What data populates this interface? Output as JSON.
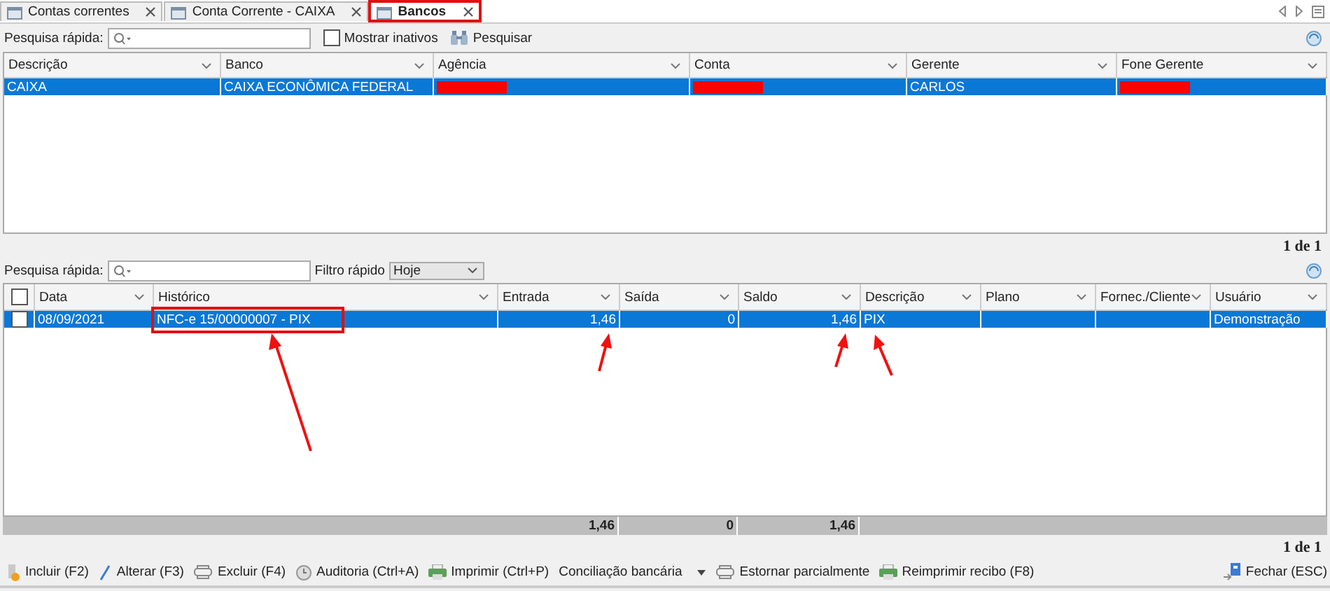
{
  "tabs": [
    {
      "label": "Contas correntes",
      "selected": false,
      "highlighted": false
    },
    {
      "label": "Conta Corrente - CAIXA",
      "selected": false,
      "highlighted": false
    },
    {
      "label": "Bancos",
      "selected": true,
      "highlighted": true
    }
  ],
  "search_bar": {
    "label": "Pesquisa rápida:",
    "show_inactive": {
      "label": "Mostrar inativos",
      "checked": false
    },
    "search_button": "Pesquisar"
  },
  "banks_table": {
    "columns": [
      {
        "label": "Descrição"
      },
      {
        "label": "Banco"
      },
      {
        "label": "Agência"
      },
      {
        "label": "Conta"
      },
      {
        "label": "Gerente"
      },
      {
        "label": "Fone Gerente"
      }
    ],
    "rows": [
      {
        "selected": true,
        "cells": [
          {
            "kind": "text",
            "text": "CAIXA"
          },
          {
            "kind": "text",
            "text": "CAIXA ECONÔMICA FEDERAL"
          },
          {
            "kind": "redacted"
          },
          {
            "kind": "redacted"
          },
          {
            "kind": "text",
            "text": "CARLOS"
          },
          {
            "kind": "redacted"
          }
        ]
      }
    ],
    "pager": "1 de 1"
  },
  "filter_bar": {
    "label": "Pesquisa rápida:",
    "filter_label": "Filtro rápido",
    "filter_value": "Hoje"
  },
  "entries_table": {
    "header_checked": false,
    "columns": [
      {
        "label": "Data",
        "kind": "text"
      },
      {
        "label": "Histórico",
        "kind": "text"
      },
      {
        "label": "Entrada",
        "kind": "number"
      },
      {
        "label": "Saída",
        "kind": "number"
      },
      {
        "label": "Saldo",
        "kind": "number"
      },
      {
        "label": "Descrição",
        "kind": "text"
      },
      {
        "label": "Plano",
        "kind": "text"
      },
      {
        "label": "Fornec./Cliente",
        "kind": "text"
      },
      {
        "label": "Usuário",
        "kind": "text"
      }
    ],
    "rows": [
      {
        "selected": true,
        "checked": false,
        "cells": [
          {
            "text": "08/09/2021"
          },
          {
            "text": "NFC-e 15/00000007 - PIX",
            "highlighted": true
          },
          {
            "text": "1,46"
          },
          {
            "text": "0"
          },
          {
            "text": "1,46"
          },
          {
            "text": "PIX"
          },
          {},
          {},
          {
            "text": "Demonstração"
          }
        ]
      }
    ],
    "totals": [
      "1,46",
      "0",
      "1,46"
    ],
    "pager": "1 de 1"
  },
  "actions": [
    {
      "label": "Incluir (F2)",
      "kind": "add"
    },
    {
      "label": "Alterar (F3)",
      "kind": "edit"
    },
    {
      "label": "Excluir (F4)",
      "kind": "delete"
    },
    {
      "label": "Auditoria (Ctrl+A)",
      "kind": "audit"
    },
    {
      "label": "Imprimir (Ctrl+P)",
      "kind": "print"
    },
    {
      "label": "Conciliação bancária",
      "kind": "dropdown"
    },
    {
      "label": "Estornar parcialmente",
      "kind": "delete"
    },
    {
      "label": "Reimprimir recibo (F8)",
      "kind": "print"
    }
  ],
  "close_button": "Fechar (ESC)"
}
